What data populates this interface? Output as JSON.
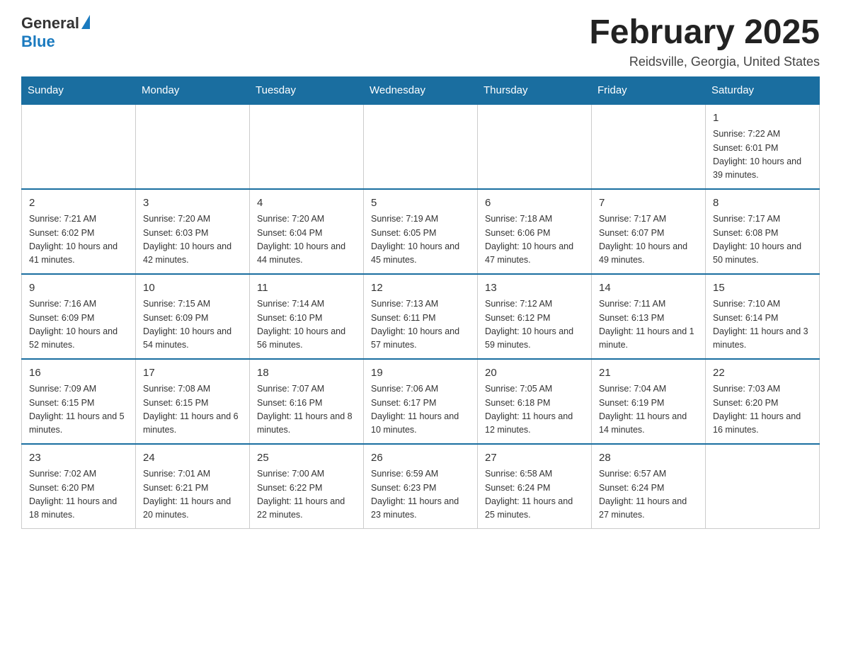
{
  "header": {
    "logo_general": "General",
    "logo_blue": "Blue",
    "month_title": "February 2025",
    "location": "Reidsville, Georgia, United States"
  },
  "days_of_week": [
    "Sunday",
    "Monday",
    "Tuesday",
    "Wednesday",
    "Thursday",
    "Friday",
    "Saturday"
  ],
  "weeks": [
    [
      {
        "day": "",
        "info": ""
      },
      {
        "day": "",
        "info": ""
      },
      {
        "day": "",
        "info": ""
      },
      {
        "day": "",
        "info": ""
      },
      {
        "day": "",
        "info": ""
      },
      {
        "day": "",
        "info": ""
      },
      {
        "day": "1",
        "info": "Sunrise: 7:22 AM\nSunset: 6:01 PM\nDaylight: 10 hours\nand 39 minutes."
      }
    ],
    [
      {
        "day": "2",
        "info": "Sunrise: 7:21 AM\nSunset: 6:02 PM\nDaylight: 10 hours\nand 41 minutes."
      },
      {
        "day": "3",
        "info": "Sunrise: 7:20 AM\nSunset: 6:03 PM\nDaylight: 10 hours\nand 42 minutes."
      },
      {
        "day": "4",
        "info": "Sunrise: 7:20 AM\nSunset: 6:04 PM\nDaylight: 10 hours\nand 44 minutes."
      },
      {
        "day": "5",
        "info": "Sunrise: 7:19 AM\nSunset: 6:05 PM\nDaylight: 10 hours\nand 45 minutes."
      },
      {
        "day": "6",
        "info": "Sunrise: 7:18 AM\nSunset: 6:06 PM\nDaylight: 10 hours\nand 47 minutes."
      },
      {
        "day": "7",
        "info": "Sunrise: 7:17 AM\nSunset: 6:07 PM\nDaylight: 10 hours\nand 49 minutes."
      },
      {
        "day": "8",
        "info": "Sunrise: 7:17 AM\nSunset: 6:08 PM\nDaylight: 10 hours\nand 50 minutes."
      }
    ],
    [
      {
        "day": "9",
        "info": "Sunrise: 7:16 AM\nSunset: 6:09 PM\nDaylight: 10 hours\nand 52 minutes."
      },
      {
        "day": "10",
        "info": "Sunrise: 7:15 AM\nSunset: 6:09 PM\nDaylight: 10 hours\nand 54 minutes."
      },
      {
        "day": "11",
        "info": "Sunrise: 7:14 AM\nSunset: 6:10 PM\nDaylight: 10 hours\nand 56 minutes."
      },
      {
        "day": "12",
        "info": "Sunrise: 7:13 AM\nSunset: 6:11 PM\nDaylight: 10 hours\nand 57 minutes."
      },
      {
        "day": "13",
        "info": "Sunrise: 7:12 AM\nSunset: 6:12 PM\nDaylight: 10 hours\nand 59 minutes."
      },
      {
        "day": "14",
        "info": "Sunrise: 7:11 AM\nSunset: 6:13 PM\nDaylight: 11 hours\nand 1 minute."
      },
      {
        "day": "15",
        "info": "Sunrise: 7:10 AM\nSunset: 6:14 PM\nDaylight: 11 hours\nand 3 minutes."
      }
    ],
    [
      {
        "day": "16",
        "info": "Sunrise: 7:09 AM\nSunset: 6:15 PM\nDaylight: 11 hours\nand 5 minutes."
      },
      {
        "day": "17",
        "info": "Sunrise: 7:08 AM\nSunset: 6:15 PM\nDaylight: 11 hours\nand 6 minutes."
      },
      {
        "day": "18",
        "info": "Sunrise: 7:07 AM\nSunset: 6:16 PM\nDaylight: 11 hours\nand 8 minutes."
      },
      {
        "day": "19",
        "info": "Sunrise: 7:06 AM\nSunset: 6:17 PM\nDaylight: 11 hours\nand 10 minutes."
      },
      {
        "day": "20",
        "info": "Sunrise: 7:05 AM\nSunset: 6:18 PM\nDaylight: 11 hours\nand 12 minutes."
      },
      {
        "day": "21",
        "info": "Sunrise: 7:04 AM\nSunset: 6:19 PM\nDaylight: 11 hours\nand 14 minutes."
      },
      {
        "day": "22",
        "info": "Sunrise: 7:03 AM\nSunset: 6:20 PM\nDaylight: 11 hours\nand 16 minutes."
      }
    ],
    [
      {
        "day": "23",
        "info": "Sunrise: 7:02 AM\nSunset: 6:20 PM\nDaylight: 11 hours\nand 18 minutes."
      },
      {
        "day": "24",
        "info": "Sunrise: 7:01 AM\nSunset: 6:21 PM\nDaylight: 11 hours\nand 20 minutes."
      },
      {
        "day": "25",
        "info": "Sunrise: 7:00 AM\nSunset: 6:22 PM\nDaylight: 11 hours\nand 22 minutes."
      },
      {
        "day": "26",
        "info": "Sunrise: 6:59 AM\nSunset: 6:23 PM\nDaylight: 11 hours\nand 23 minutes."
      },
      {
        "day": "27",
        "info": "Sunrise: 6:58 AM\nSunset: 6:24 PM\nDaylight: 11 hours\nand 25 minutes."
      },
      {
        "day": "28",
        "info": "Sunrise: 6:57 AM\nSunset: 6:24 PM\nDaylight: 11 hours\nand 27 minutes."
      },
      {
        "day": "",
        "info": ""
      }
    ]
  ]
}
